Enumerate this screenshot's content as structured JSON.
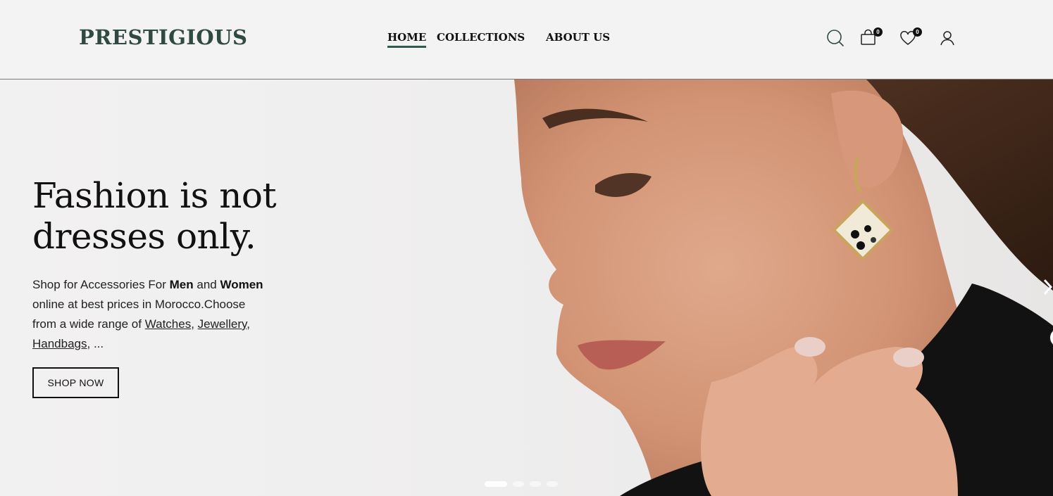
{
  "header": {
    "logo": "PRESTIGIOUS",
    "nav": {
      "home": "HOME",
      "collections": "COLLECTIONS",
      "about": "ABOUT US"
    },
    "cart_count": "0",
    "wishlist_count": "0",
    "icons": [
      "search-icon",
      "shopping-bag-icon",
      "heart-icon",
      "user-icon"
    ]
  },
  "hero": {
    "title": "Fashion is not dresses only.",
    "text": {
      "part1": "Shop for Accessories For ",
      "men": "Men",
      "part2": " and ",
      "women": "Women",
      "part3": " online at best prices in Morocco.Choose from a wide range of ",
      "link_watches": "Watches",
      "sep1": ", ",
      "link_jewellery": "Jewellery",
      "sep2": ", ",
      "link_handbags": "Handbags",
      "ellipsis": ", ..."
    },
    "button": "SHOP NOW",
    "slide_count": 4,
    "active_slide": 1
  },
  "colors": {
    "brand": "#2f4a42",
    "nav_underline": "#2f5a4f",
    "background": "#f3f3f3"
  }
}
